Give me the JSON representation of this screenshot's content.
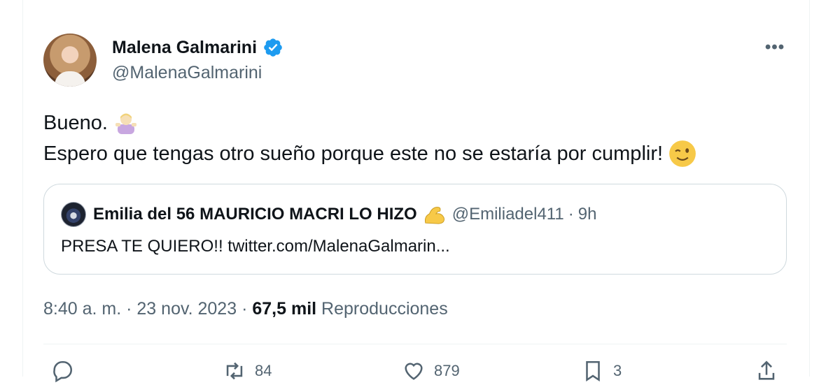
{
  "author": {
    "display_name": "Malena Galmarini",
    "handle": "@MalenaGalmarini",
    "verified": true
  },
  "tweet": {
    "line1": "Bueno.",
    "line1_emoji": "woman-shrugging-emoji",
    "line2": "Espero que tengas otro sueño porque este no se estaría por cumplir!",
    "line2_emoji": "winking-face-emoji"
  },
  "quoted": {
    "display_name": "Emilia del 56 MAURICIO MACRI LO HIZO",
    "name_emoji": "flexed-biceps-emoji",
    "handle": "@Emiliadel411",
    "separator": "·",
    "time": "9h",
    "text": "PRESA TE QUIERO!! twitter.com/MalenaGalmarin..."
  },
  "meta": {
    "time": "8:40 a. m.",
    "sep1": "·",
    "date": "23 nov. 2023",
    "sep2": "·",
    "views_count": "67,5 mil",
    "views_label": "Reproducciones"
  },
  "actions": {
    "reply_count": "",
    "retweet_count": "84",
    "like_count": "879",
    "bookmark_count": "3"
  },
  "colors": {
    "text_primary": "#0f1419",
    "text_secondary": "#536471",
    "verified_blue": "#1d9bf0",
    "border": "#cfd9de"
  }
}
